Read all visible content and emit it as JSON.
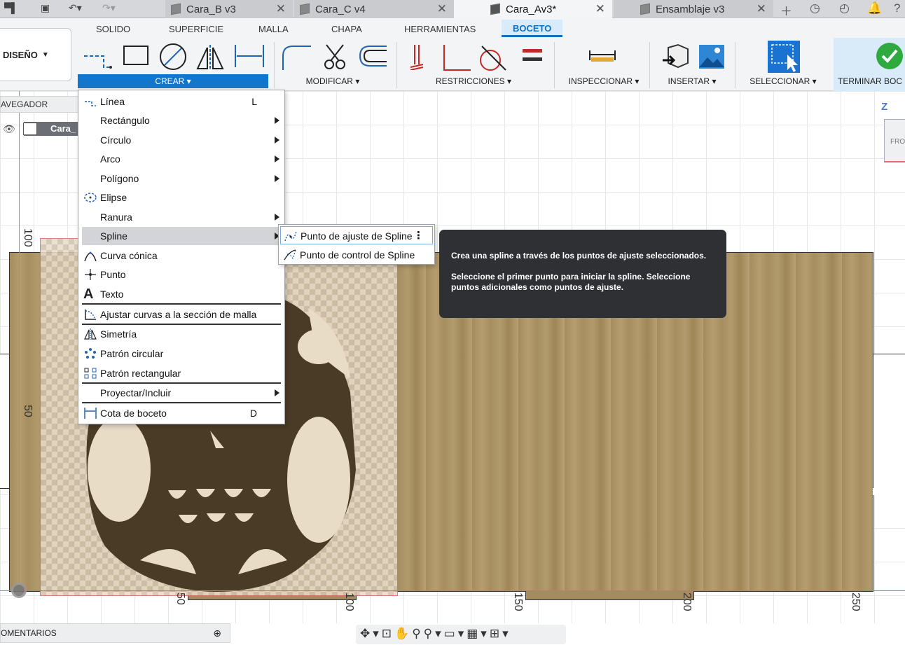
{
  "tabs": [
    {
      "label": "Cara_B v3",
      "active": false
    },
    {
      "label": "Cara_C v4",
      "active": false
    },
    {
      "label": "Cara_Av3*",
      "active": true
    },
    {
      "label": "Ensamblaje v3",
      "active": false
    }
  ],
  "ribbon": {
    "workspace": "DISEÑO",
    "tabs": [
      "SOLIDO",
      "SUPERFICIE",
      "MALLA",
      "CHAPA",
      "HERRAMIENTAS",
      "BOCETO"
    ],
    "active_tab": "BOCETO",
    "groups": [
      "CREAR",
      "MODIFICAR",
      "RESTRICCIONES",
      "INSPECCIONAR",
      "INSERTAR",
      "SELECCIONAR",
      "TERMINAR BOC"
    ]
  },
  "browser": {
    "header": "AVEGADOR",
    "item": "Cara_"
  },
  "create_menu": {
    "items": [
      {
        "label": "Línea",
        "shortcut": "L",
        "submenu": false,
        "icon": "line-icon"
      },
      {
        "label": "Rectángulo",
        "submenu": true
      },
      {
        "label": "Círculo",
        "submenu": true
      },
      {
        "label": "Arco",
        "submenu": true
      },
      {
        "label": "Polígono",
        "submenu": true
      },
      {
        "label": "Elipse",
        "submenu": false,
        "icon": "ellipse-icon"
      },
      {
        "label": "Ranura",
        "submenu": true
      },
      {
        "label": "Spline",
        "submenu": true,
        "highlighted": true
      },
      {
        "label": "Curva cónica",
        "submenu": false,
        "icon": "conic-curve-icon"
      },
      {
        "label": "Punto",
        "submenu": false,
        "icon": "point-icon"
      },
      {
        "label": "Texto",
        "submenu": false,
        "icon": "text-icon"
      },
      {
        "label": "Ajustar curvas a la sección de malla",
        "submenu": false,
        "icon": "fit-curves-icon"
      },
      {
        "label": "Simetría",
        "submenu": false,
        "icon": "mirror-icon"
      },
      {
        "label": "Patrón circular",
        "submenu": false,
        "icon": "circular-pattern-icon"
      },
      {
        "label": "Patrón rectangular",
        "submenu": false,
        "icon": "rectangular-pattern-icon"
      },
      {
        "label": "Proyectar/Incluir",
        "submenu": true
      },
      {
        "label": "Cota de boceto",
        "shortcut": "D",
        "submenu": false,
        "icon": "dimension-icon"
      }
    ]
  },
  "spline_submenu": {
    "items": [
      {
        "label": "Punto de ajuste de Spline",
        "more": "⋮"
      },
      {
        "label": "Punto de control de Spline"
      }
    ]
  },
  "tooltip": {
    "line1": "Crea una spline a través de los puntos de ajuste seleccionados.",
    "line2": "Seleccione el primer punto para iniciar la spline. Seleccione puntos adicionales como puntos de ajuste."
  },
  "canvas": {
    "ruler_vertical": [
      "100",
      "50"
    ],
    "ruler_horizontal": [
      "50",
      "100",
      "150",
      "200",
      "250"
    ],
    "viewcube_label": "FRO",
    "axis_label": "Z"
  },
  "status": {
    "comments": "OMENTARIOS"
  },
  "colors": {
    "accent": "#1277cc",
    "tooltip_bg": "#2f3033",
    "wood": "#a58c5f"
  }
}
